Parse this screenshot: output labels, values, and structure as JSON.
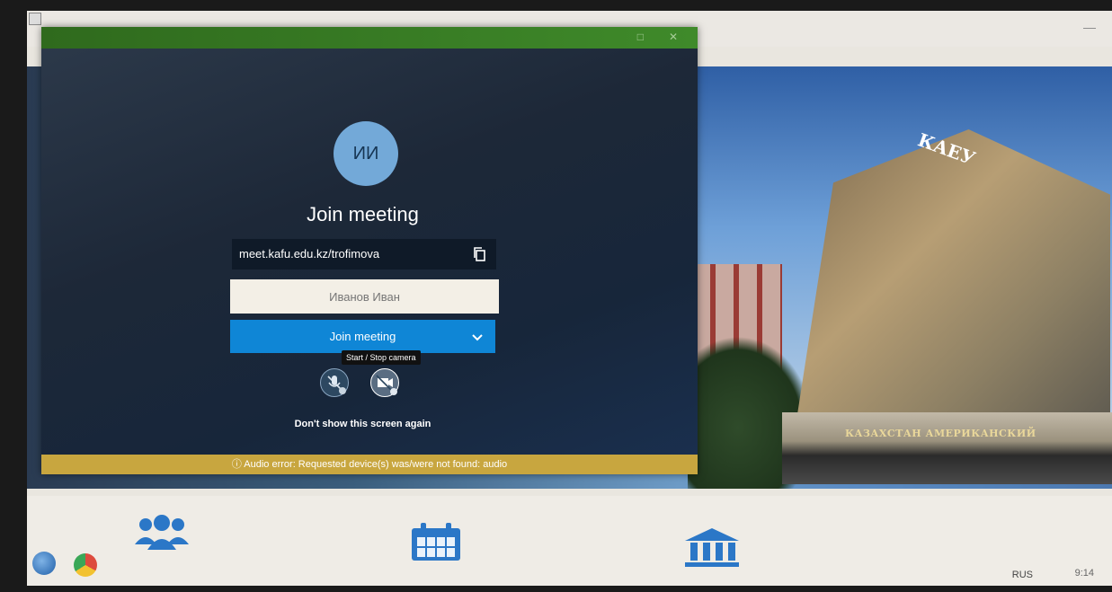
{
  "dialog": {
    "avatar_initials": "ИИ",
    "heading": "Join meeting",
    "url": "meet.kafu.edu.kz/trofimova",
    "name_placeholder": "Иванов Иван",
    "join_button_label": "Join meeting",
    "tooltip": "Start / Stop camera",
    "dont_show_label": "Don't show this screen again",
    "error_message": "Audio error: Requested device(s) was/were not found: audio"
  },
  "background": {
    "tower_sign": "КАЕУ",
    "base_sign": "КАЗАХСТАН АМЕРИКАНСКИЙ"
  },
  "taskbar": {
    "language": "RUS",
    "clock": "9:14"
  },
  "colors": {
    "join_button": "#0f86d6",
    "error_bar": "#c8a63f",
    "title_bar": "#3f8a2a",
    "avatar": "#73a9d8"
  },
  "icons": [
    "copy-icon",
    "chevron-down-icon",
    "mic-off-icon",
    "camera-off-icon",
    "users-icon",
    "calendar-icon",
    "building-icon",
    "info-icon"
  ]
}
